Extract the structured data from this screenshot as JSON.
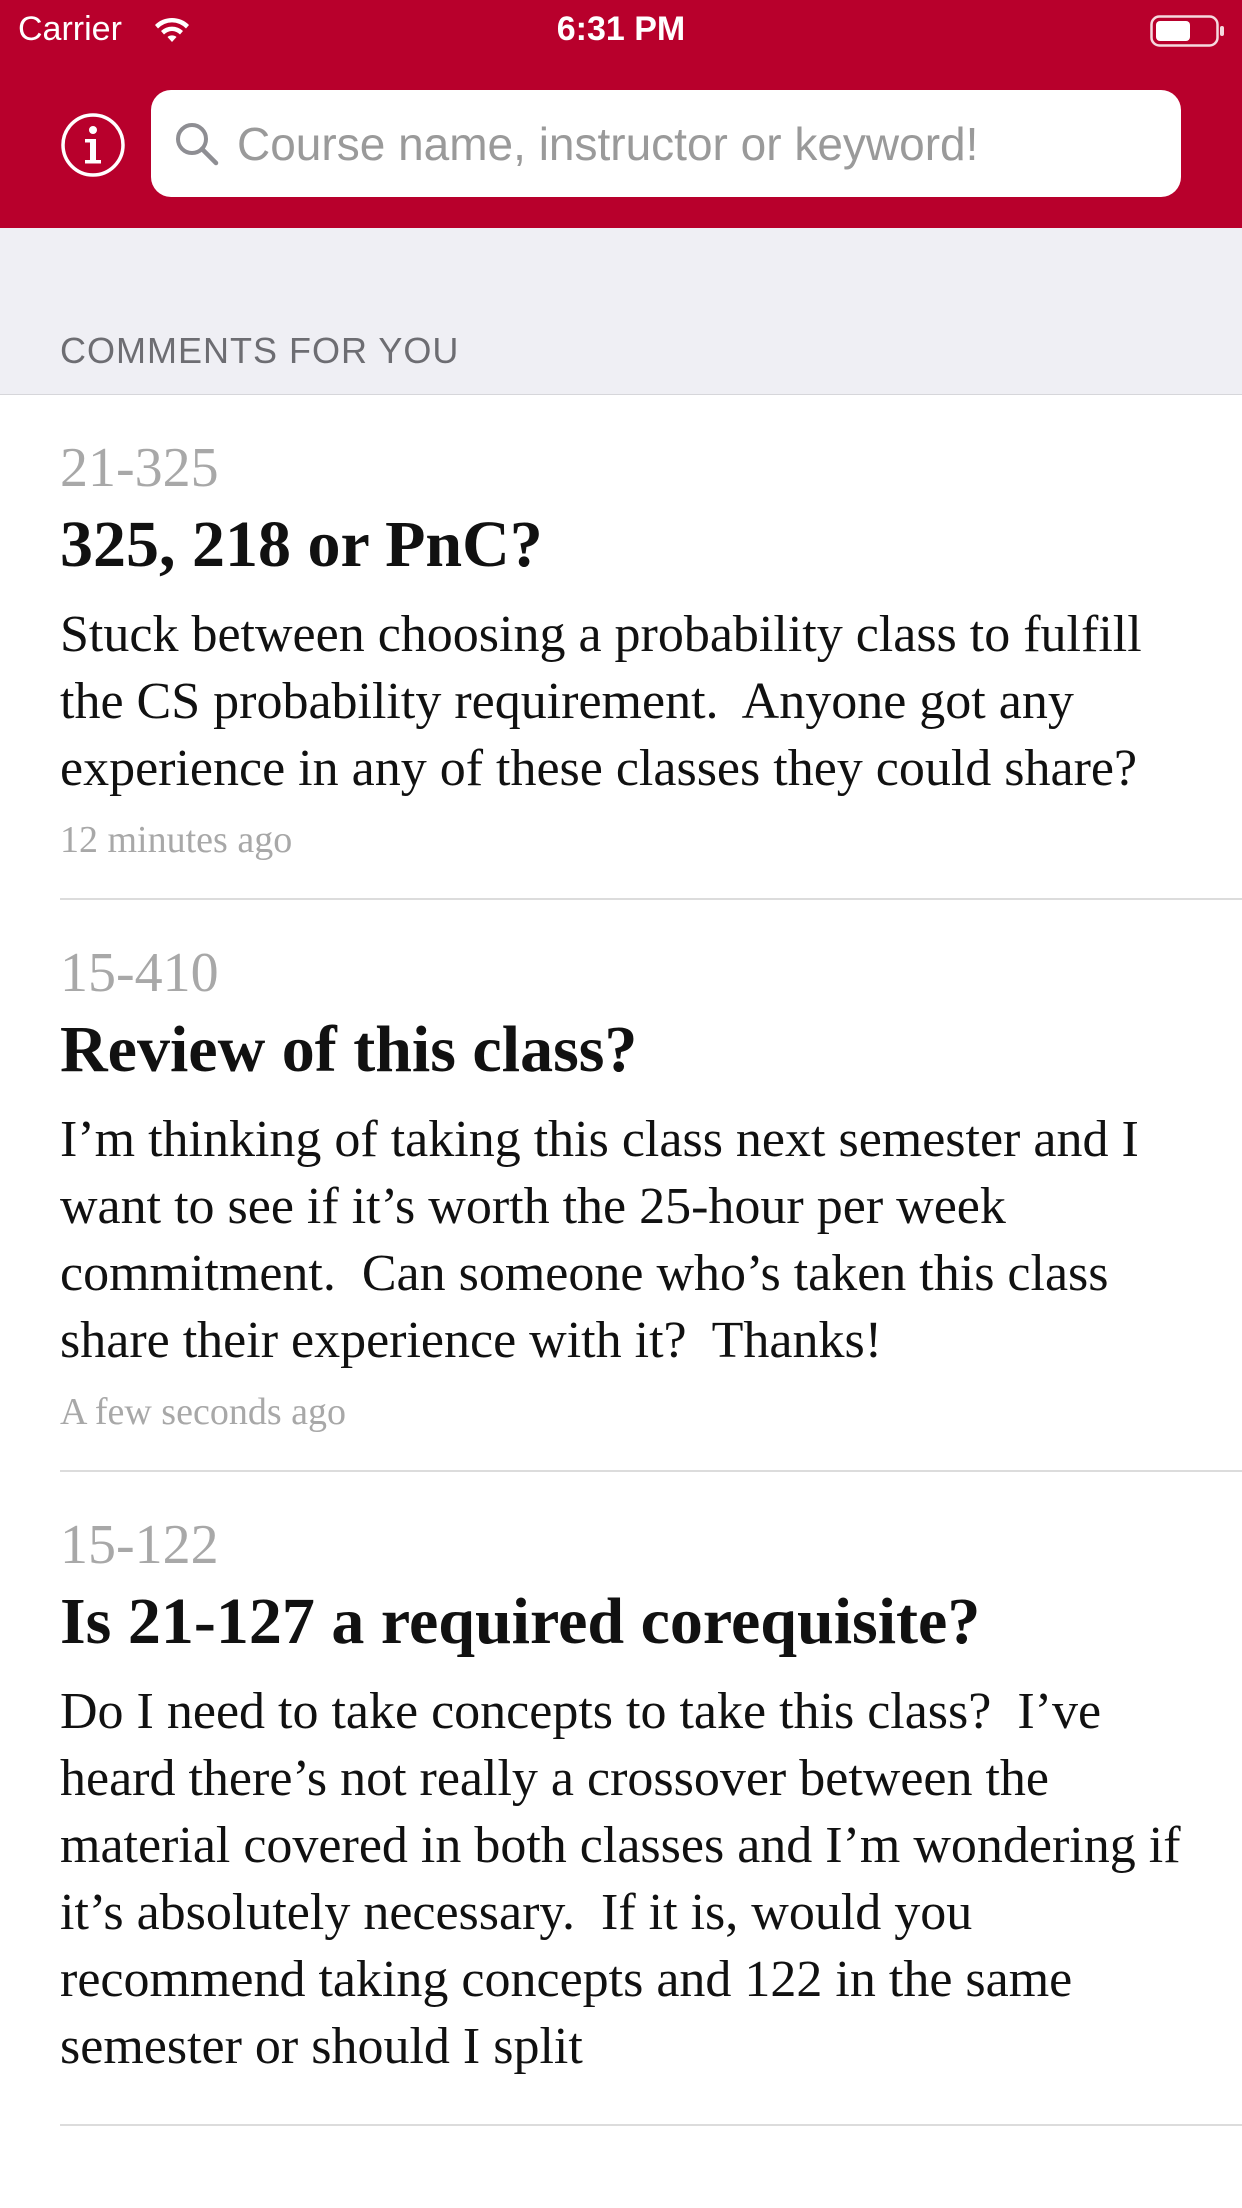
{
  "status_bar": {
    "carrier": "Carrier",
    "time": "6:31 PM"
  },
  "header": {
    "accent_color": "#b8002c",
    "info_icon": "info-icon",
    "search": {
      "icon": "search-icon",
      "value": "",
      "placeholder": "Course name, instructor or keyword!"
    }
  },
  "section": {
    "title": "COMMENTS FOR YOU"
  },
  "comments": [
    {
      "course": "21-325",
      "title": "325, 218 or PnC?",
      "body": "Stuck between choosing a probability class to fulfill the CS probability requirement.  Anyone got any experience in any of these classes they could share?",
      "timestamp": "12 minutes ago"
    },
    {
      "course": "15-410",
      "title": "Review of this class?",
      "body": "I’m thinking of taking this class next semester and I want to see if it’s worth the 25-hour per week commitment.  Can someone who’s taken this class share their experience with it?  Thanks!",
      "timestamp": "A few seconds ago"
    },
    {
      "course": "15-122",
      "title": "Is 21-127 a required corequisite?",
      "body": "Do I need to take concepts to take this class?  I’ve heard there’s not really a crossover between the material covered in both classes and I’m wondering if it’s absolutely necessary.  If it is, would you recommend taking concepts and 122 in the same semester or should I split",
      "timestamp": ""
    }
  ]
}
